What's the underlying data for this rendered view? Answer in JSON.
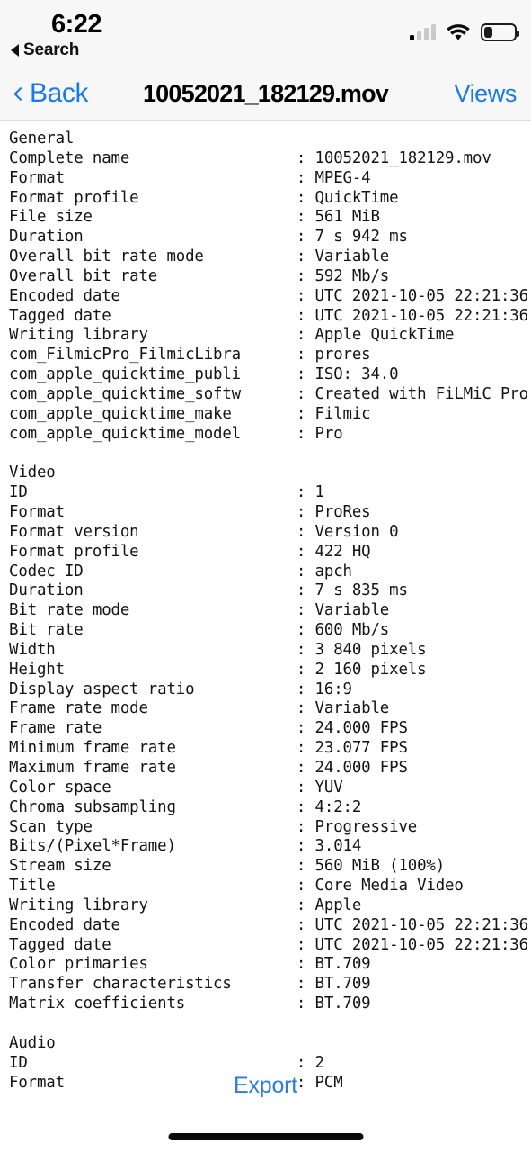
{
  "status_bar": {
    "time": "6:22",
    "back_link_label": "Search",
    "back_link_icon": "left-triangle-icon",
    "cellular_icon": "cellular-bars-icon",
    "cellular_bars_active": 1,
    "wifi_icon": "wifi-icon",
    "battery_icon": "battery-icon",
    "battery_percent": 28
  },
  "nav_bar": {
    "back_label": "Back",
    "back_icon": "chevron-left-icon",
    "title": "10052021_182129.mov",
    "views_label": "Views",
    "accent_color": "#1a7aec"
  },
  "footer": {
    "export_label": "Export",
    "export_color": "#2b7be4",
    "home_indicator": "home-indicator"
  },
  "report": {
    "label_column_width": 31,
    "clipped_at_right_edge": true,
    "sections": [
      {
        "name": "General",
        "rows": [
          {
            "label": "Complete name",
            "value": "10052021_182129.mov"
          },
          {
            "label": "Format",
            "value": "MPEG-4"
          },
          {
            "label": "Format profile",
            "value": "QuickTime"
          },
          {
            "label": "File size",
            "value": "561 MiB"
          },
          {
            "label": "Duration",
            "value": "7 s 942 ms"
          },
          {
            "label": "Overall bit rate mode",
            "value": "Variable"
          },
          {
            "label": "Overall bit rate",
            "value": "592 Mb/s"
          },
          {
            "label": "Encoded date",
            "value": "UTC 2021-10-05 22:21:36"
          },
          {
            "label": "Tagged date",
            "value": "UTC 2021-10-05 22:21:36"
          },
          {
            "label": "Writing library",
            "value": "Apple QuickTime"
          },
          {
            "label": "com_FilmicPro_FilmicLibra",
            "value": "prores"
          },
          {
            "label": "com_apple_quicktime_publi",
            "value": "ISO: 34.0"
          },
          {
            "label": "com_apple_quicktime_softw",
            "value": "Created with FiLMiC Pro"
          },
          {
            "label": "com_apple_quicktime_make",
            "value": "Filmic"
          },
          {
            "label": "com_apple_quicktime_model",
            "value": "Pro"
          }
        ]
      },
      {
        "name": "Video",
        "rows": [
          {
            "label": "ID",
            "value": "1"
          },
          {
            "label": "Format",
            "value": "ProRes"
          },
          {
            "label": "Format version",
            "value": "Version 0"
          },
          {
            "label": "Format profile",
            "value": "422 HQ"
          },
          {
            "label": "Codec ID",
            "value": "apch"
          },
          {
            "label": "Duration",
            "value": "7 s 835 ms"
          },
          {
            "label": "Bit rate mode",
            "value": "Variable"
          },
          {
            "label": "Bit rate",
            "value": "600 Mb/s"
          },
          {
            "label": "Width",
            "value": "3 840 pixels"
          },
          {
            "label": "Height",
            "value": "2 160 pixels"
          },
          {
            "label": "Display aspect ratio",
            "value": "16:9"
          },
          {
            "label": "Frame rate mode",
            "value": "Variable"
          },
          {
            "label": "Frame rate",
            "value": "24.000 FPS"
          },
          {
            "label": "Minimum frame rate",
            "value": "23.077 FPS"
          },
          {
            "label": "Maximum frame rate",
            "value": "24.000 FPS"
          },
          {
            "label": "Color space",
            "value": "YUV"
          },
          {
            "label": "Chroma subsampling",
            "value": "4:2:2"
          },
          {
            "label": "Scan type",
            "value": "Progressive"
          },
          {
            "label": "Bits/(Pixel*Frame)",
            "value": "3.014"
          },
          {
            "label": "Stream size",
            "value": "560 MiB (100%)"
          },
          {
            "label": "Title",
            "value": "Core Media Video"
          },
          {
            "label": "Writing library",
            "value": "Apple"
          },
          {
            "label": "Encoded date",
            "value": "UTC 2021-10-05 22:21:36"
          },
          {
            "label": "Tagged date",
            "value": "UTC 2021-10-05 22:21:36"
          },
          {
            "label": "Color primaries",
            "value": "BT.709"
          },
          {
            "label": "Transfer characteristics",
            "value": "BT.709"
          },
          {
            "label": "Matrix coefficients",
            "value": "BT.709"
          }
        ]
      },
      {
        "name": "Audio",
        "rows": [
          {
            "label": "ID",
            "value": "2"
          },
          {
            "label": "Format",
            "value": "PCM"
          }
        ]
      }
    ]
  }
}
